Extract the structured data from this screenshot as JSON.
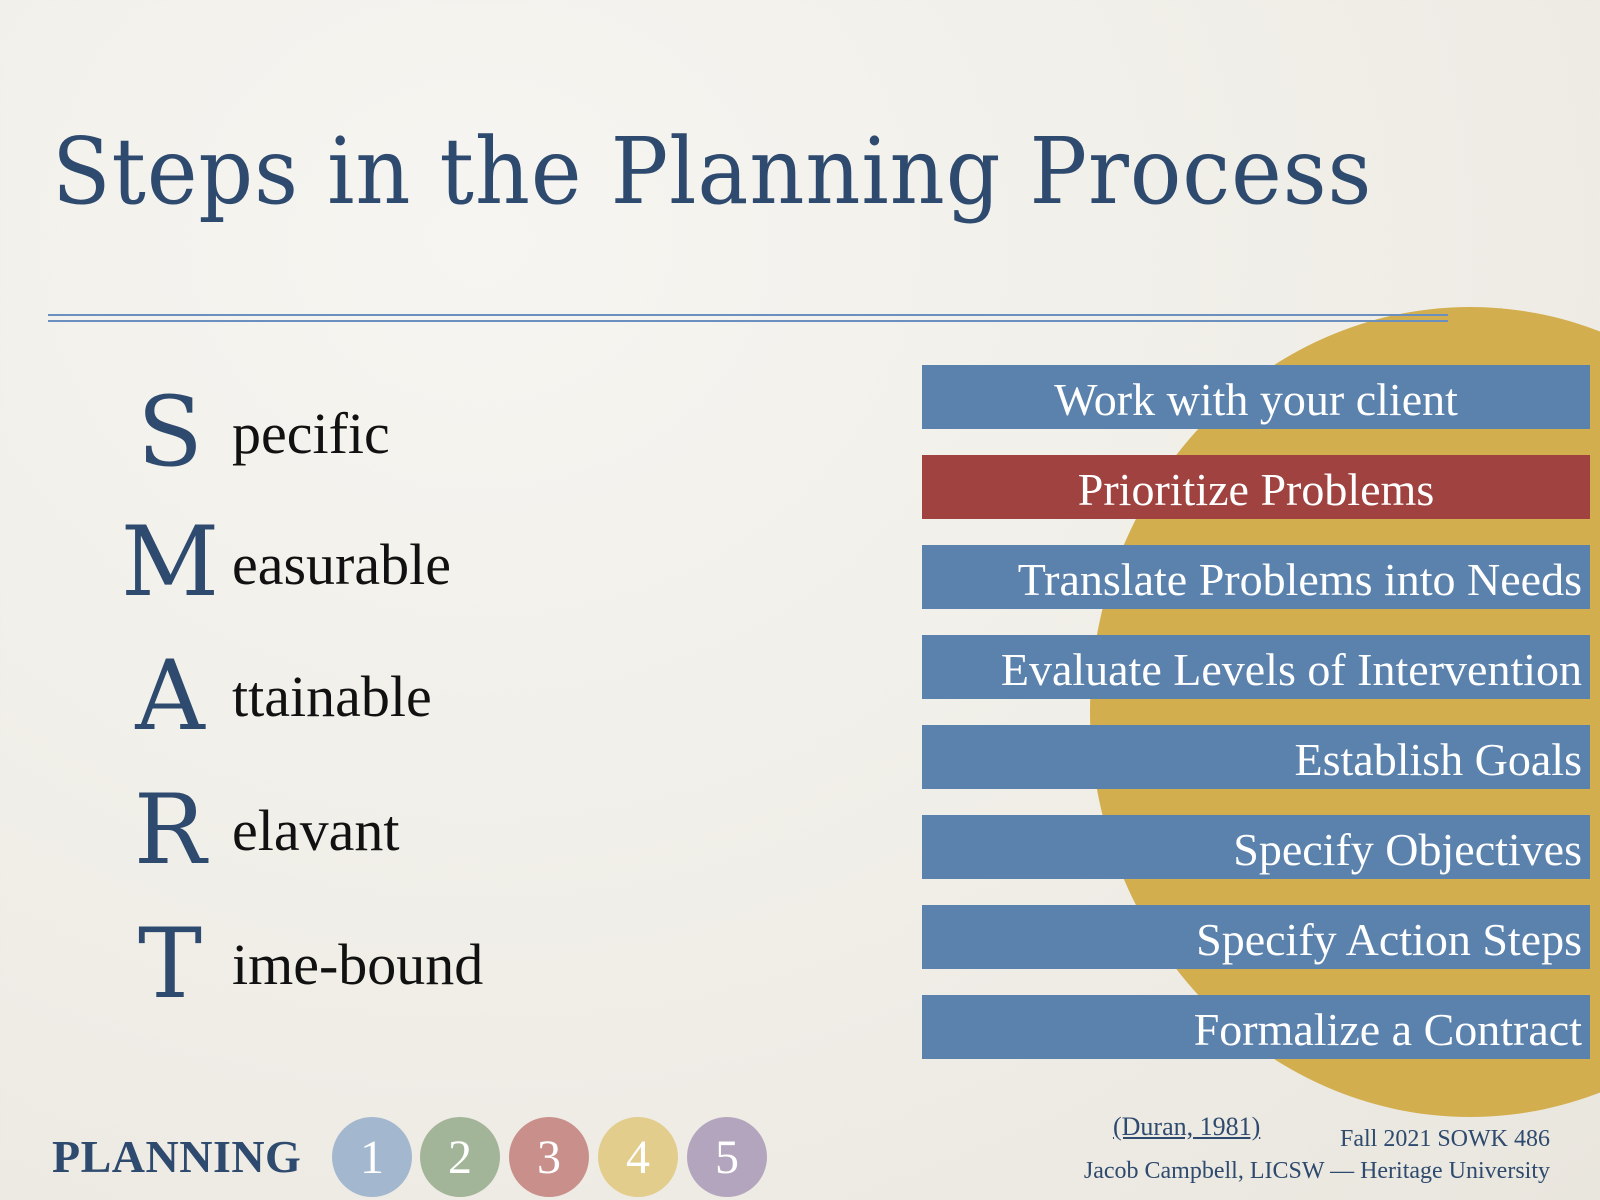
{
  "slide": {
    "title": "Steps in the Planning Process",
    "colors": {
      "title": "#2e4a6e",
      "rule": "#6b90bf",
      "accent_circle": "#d3ae4e",
      "step_bar": "#5b82ad",
      "step_bar_highlight": "#a0423f"
    },
    "smart": [
      {
        "letter": "S",
        "rest": "pecific"
      },
      {
        "letter": "M",
        "rest": "easurable"
      },
      {
        "letter": "A",
        "rest": "ttainable"
      },
      {
        "letter": "R",
        "rest": "elavant"
      },
      {
        "letter": "T",
        "rest": "ime-bound"
      }
    ],
    "steps": [
      {
        "label": "Work with your client",
        "highlighted": false
      },
      {
        "label": "Prioritize Problems",
        "highlighted": true
      },
      {
        "label": "Translate Problems into Needs",
        "highlighted": false
      },
      {
        "label": "Evaluate Levels of Intervention",
        "highlighted": false
      },
      {
        "label": "Establish Goals",
        "highlighted": false
      },
      {
        "label": "Specify Objectives",
        "highlighted": false
      },
      {
        "label": "Specify Action Steps",
        "highlighted": false
      },
      {
        "label": "Formalize a Contract",
        "highlighted": false
      }
    ],
    "footer": {
      "section_label": "PLANNING",
      "pages": [
        {
          "label": "1",
          "color": "#a3b8cf"
        },
        {
          "label": "2",
          "color": "#a3b598"
        },
        {
          "label": "3",
          "color": "#c98f8b"
        },
        {
          "label": "4",
          "color": "#e3cd8d"
        },
        {
          "label": "5",
          "color": "#b3a5bd"
        }
      ],
      "citation": "(Duran, 1981)",
      "course": "Fall 2021 SOWK 486",
      "author": "Jacob Campbell, LICSW — Heritage University"
    }
  }
}
